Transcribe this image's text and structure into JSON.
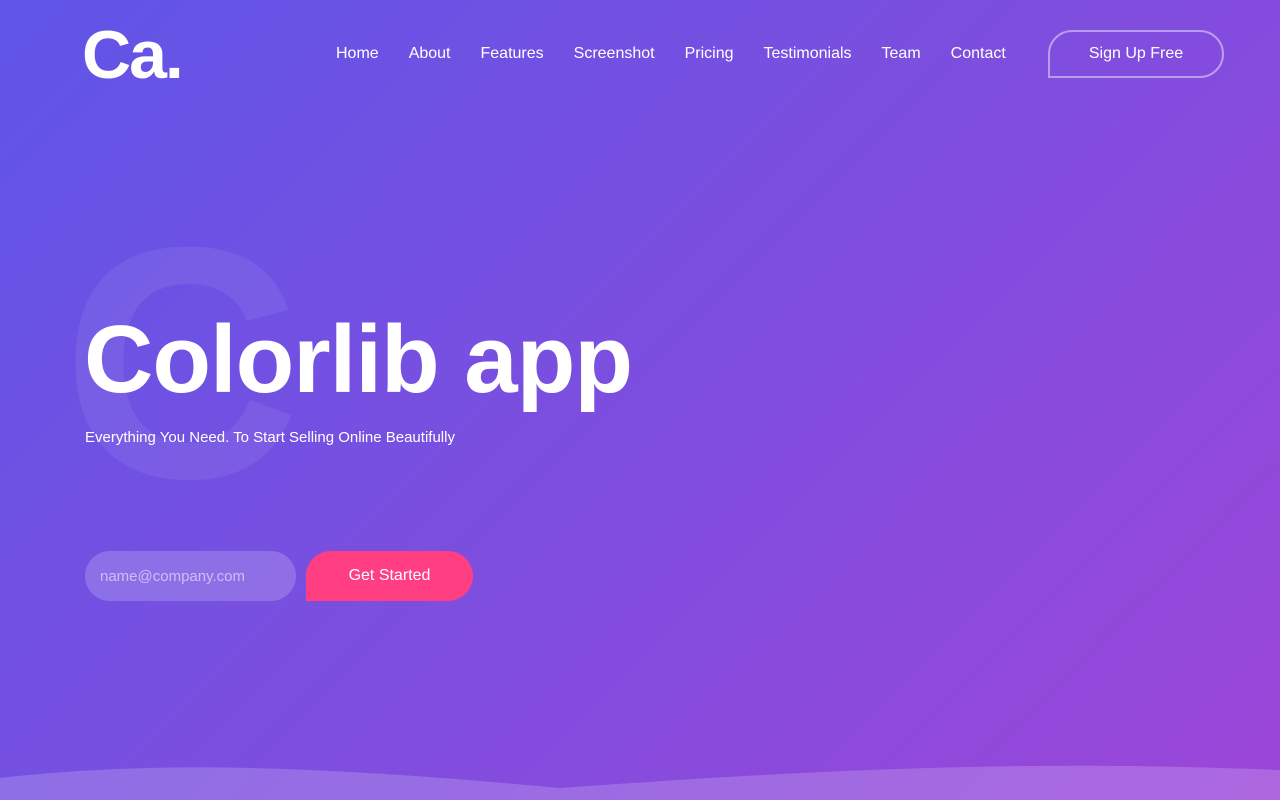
{
  "header": {
    "logo_text": "Ca.",
    "nav": [
      {
        "label": "Home"
      },
      {
        "label": "About"
      },
      {
        "label": "Features"
      },
      {
        "label": "Screenshot"
      },
      {
        "label": "Pricing"
      },
      {
        "label": "Testimonials"
      },
      {
        "label": "Team"
      },
      {
        "label": "Contact"
      }
    ],
    "signup_label": "Sign Up Free"
  },
  "hero": {
    "watermark_letter": "C",
    "title": "Colorlib app",
    "subtitle": "Everything You Need. To Start Selling Online Beautifully",
    "email_placeholder": "name@company.com",
    "cta_label": "Get Started"
  },
  "colors": {
    "background_start": "#5f55e8",
    "background_end": "#9b46d8",
    "cta": "#ff3f82",
    "text": "#ffffff"
  }
}
